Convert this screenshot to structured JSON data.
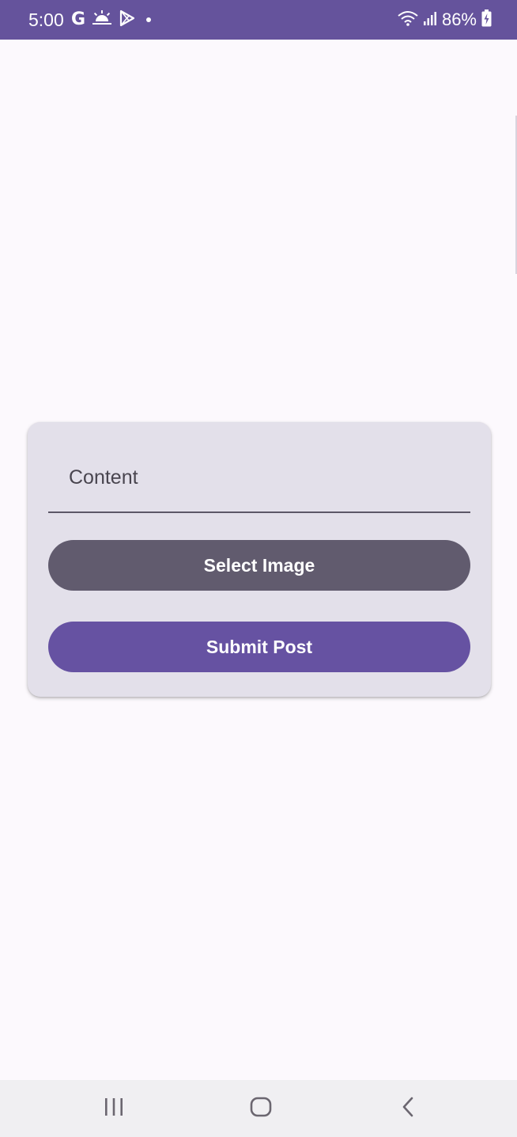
{
  "status_bar": {
    "time": "5:00",
    "google_glyph": "G",
    "battery_percent": "86%",
    "icons_left": [
      "google-icon",
      "weather-icon",
      "play-store-icon",
      "notification-dot-icon"
    ],
    "icons_right": [
      "wifi-icon",
      "signal-icon",
      "battery-charging-icon"
    ],
    "background_color": "#65539c"
  },
  "post_form": {
    "content_field": {
      "placeholder": "Content",
      "value": ""
    },
    "select_image_label": "Select Image",
    "submit_post_label": "Submit Post",
    "colors": {
      "card": "#e3e0ea",
      "select_button": "#615b6e",
      "submit_button": "#6652a2"
    }
  },
  "nav_bar": {
    "items": [
      "recents-icon",
      "home-icon",
      "back-icon"
    ]
  }
}
